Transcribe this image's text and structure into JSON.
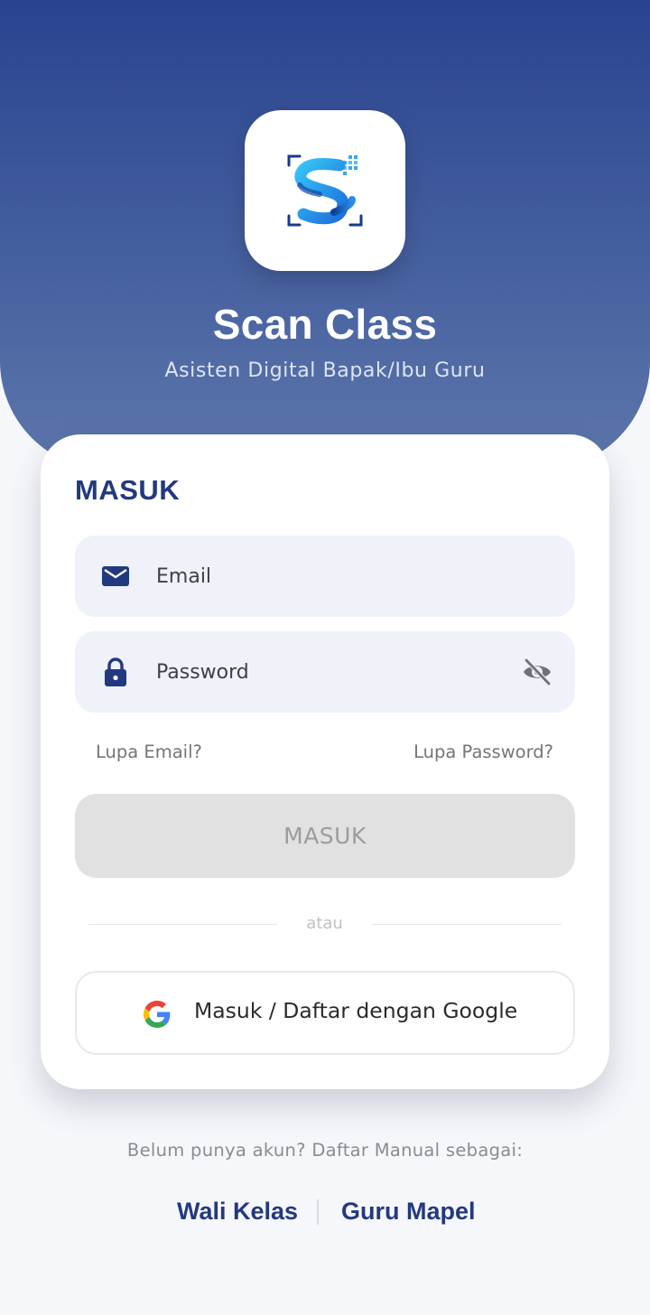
{
  "app": {
    "name": "Scan Class",
    "tagline": "Asisten Digital Bapak/Ibu Guru",
    "logo_icon": "scan-class-logo-icon"
  },
  "login": {
    "title": "MASUK",
    "email": {
      "placeholder": "Email",
      "value": "",
      "icon": "envelope-icon"
    },
    "password": {
      "placeholder": "Password",
      "value": "",
      "icon": "lock-icon",
      "toggle_icon": "eye-off-icon"
    },
    "forgot_email": "Lupa Email?",
    "forgot_password": "Lupa Password?",
    "submit_label": "MASUK",
    "divider_text": "atau",
    "google_label": "Masuk / Daftar dengan Google",
    "google_icon": "google-g-icon"
  },
  "footer": {
    "prompt": "Belum punya akun? Daftar Manual sebagai:",
    "option_1": "Wali Kelas",
    "option_2": "Guru Mapel"
  },
  "colors": {
    "primary": "#23397f",
    "hero_top": "#2a4390",
    "hero_bottom": "#5d76ab",
    "field_bg": "#eff2f9",
    "button_disabled": "#e1e1e1"
  }
}
